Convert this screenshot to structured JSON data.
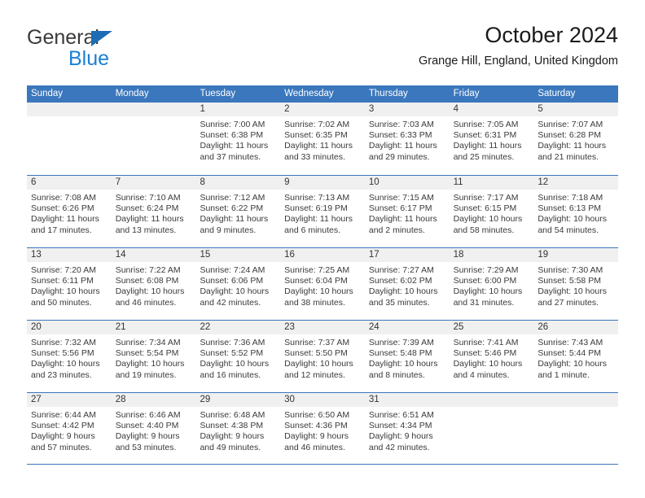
{
  "brand": {
    "name_top": "General",
    "name_bottom": "Blue",
    "triangle_color": "#1d6cb5",
    "blue_text_color": "#1b7fd4"
  },
  "header": {
    "title": "October 2024",
    "subtitle": "Grange Hill, England, United Kingdom"
  },
  "colors": {
    "header_blue": "#3b77bd",
    "day_band_gray": "#f0f0f0",
    "text": "#3a3a3a"
  },
  "weekdays": [
    "Sunday",
    "Monday",
    "Tuesday",
    "Wednesday",
    "Thursday",
    "Friday",
    "Saturday"
  ],
  "labels": {
    "sunrise": "Sunrise:",
    "sunset": "Sunset:",
    "daylight": "Daylight:"
  },
  "weeks": [
    [
      {
        "day": "",
        "sunrise": "",
        "sunset": "",
        "daylight_1": "",
        "daylight_2": ""
      },
      {
        "day": "",
        "sunrise": "",
        "sunset": "",
        "daylight_1": "",
        "daylight_2": ""
      },
      {
        "day": "1",
        "sunrise": "Sunrise: 7:00 AM",
        "sunset": "Sunset: 6:38 PM",
        "daylight_1": "Daylight: 11 hours",
        "daylight_2": "and 37 minutes."
      },
      {
        "day": "2",
        "sunrise": "Sunrise: 7:02 AM",
        "sunset": "Sunset: 6:35 PM",
        "daylight_1": "Daylight: 11 hours",
        "daylight_2": "and 33 minutes."
      },
      {
        "day": "3",
        "sunrise": "Sunrise: 7:03 AM",
        "sunset": "Sunset: 6:33 PM",
        "daylight_1": "Daylight: 11 hours",
        "daylight_2": "and 29 minutes."
      },
      {
        "day": "4",
        "sunrise": "Sunrise: 7:05 AM",
        "sunset": "Sunset: 6:31 PM",
        "daylight_1": "Daylight: 11 hours",
        "daylight_2": "and 25 minutes."
      },
      {
        "day": "5",
        "sunrise": "Sunrise: 7:07 AM",
        "sunset": "Sunset: 6:28 PM",
        "daylight_1": "Daylight: 11 hours",
        "daylight_2": "and 21 minutes."
      }
    ],
    [
      {
        "day": "6",
        "sunrise": "Sunrise: 7:08 AM",
        "sunset": "Sunset: 6:26 PM",
        "daylight_1": "Daylight: 11 hours",
        "daylight_2": "and 17 minutes."
      },
      {
        "day": "7",
        "sunrise": "Sunrise: 7:10 AM",
        "sunset": "Sunset: 6:24 PM",
        "daylight_1": "Daylight: 11 hours",
        "daylight_2": "and 13 minutes."
      },
      {
        "day": "8",
        "sunrise": "Sunrise: 7:12 AM",
        "sunset": "Sunset: 6:22 PM",
        "daylight_1": "Daylight: 11 hours",
        "daylight_2": "and 9 minutes."
      },
      {
        "day": "9",
        "sunrise": "Sunrise: 7:13 AM",
        "sunset": "Sunset: 6:19 PM",
        "daylight_1": "Daylight: 11 hours",
        "daylight_2": "and 6 minutes."
      },
      {
        "day": "10",
        "sunrise": "Sunrise: 7:15 AM",
        "sunset": "Sunset: 6:17 PM",
        "daylight_1": "Daylight: 11 hours",
        "daylight_2": "and 2 minutes."
      },
      {
        "day": "11",
        "sunrise": "Sunrise: 7:17 AM",
        "sunset": "Sunset: 6:15 PM",
        "daylight_1": "Daylight: 10 hours",
        "daylight_2": "and 58 minutes."
      },
      {
        "day": "12",
        "sunrise": "Sunrise: 7:18 AM",
        "sunset": "Sunset: 6:13 PM",
        "daylight_1": "Daylight: 10 hours",
        "daylight_2": "and 54 minutes."
      }
    ],
    [
      {
        "day": "13",
        "sunrise": "Sunrise: 7:20 AM",
        "sunset": "Sunset: 6:11 PM",
        "daylight_1": "Daylight: 10 hours",
        "daylight_2": "and 50 minutes."
      },
      {
        "day": "14",
        "sunrise": "Sunrise: 7:22 AM",
        "sunset": "Sunset: 6:08 PM",
        "daylight_1": "Daylight: 10 hours",
        "daylight_2": "and 46 minutes."
      },
      {
        "day": "15",
        "sunrise": "Sunrise: 7:24 AM",
        "sunset": "Sunset: 6:06 PM",
        "daylight_1": "Daylight: 10 hours",
        "daylight_2": "and 42 minutes."
      },
      {
        "day": "16",
        "sunrise": "Sunrise: 7:25 AM",
        "sunset": "Sunset: 6:04 PM",
        "daylight_1": "Daylight: 10 hours",
        "daylight_2": "and 38 minutes."
      },
      {
        "day": "17",
        "sunrise": "Sunrise: 7:27 AM",
        "sunset": "Sunset: 6:02 PM",
        "daylight_1": "Daylight: 10 hours",
        "daylight_2": "and 35 minutes."
      },
      {
        "day": "18",
        "sunrise": "Sunrise: 7:29 AM",
        "sunset": "Sunset: 6:00 PM",
        "daylight_1": "Daylight: 10 hours",
        "daylight_2": "and 31 minutes."
      },
      {
        "day": "19",
        "sunrise": "Sunrise: 7:30 AM",
        "sunset": "Sunset: 5:58 PM",
        "daylight_1": "Daylight: 10 hours",
        "daylight_2": "and 27 minutes."
      }
    ],
    [
      {
        "day": "20",
        "sunrise": "Sunrise: 7:32 AM",
        "sunset": "Sunset: 5:56 PM",
        "daylight_1": "Daylight: 10 hours",
        "daylight_2": "and 23 minutes."
      },
      {
        "day": "21",
        "sunrise": "Sunrise: 7:34 AM",
        "sunset": "Sunset: 5:54 PM",
        "daylight_1": "Daylight: 10 hours",
        "daylight_2": "and 19 minutes."
      },
      {
        "day": "22",
        "sunrise": "Sunrise: 7:36 AM",
        "sunset": "Sunset: 5:52 PM",
        "daylight_1": "Daylight: 10 hours",
        "daylight_2": "and 16 minutes."
      },
      {
        "day": "23",
        "sunrise": "Sunrise: 7:37 AM",
        "sunset": "Sunset: 5:50 PM",
        "daylight_1": "Daylight: 10 hours",
        "daylight_2": "and 12 minutes."
      },
      {
        "day": "24",
        "sunrise": "Sunrise: 7:39 AM",
        "sunset": "Sunset: 5:48 PM",
        "daylight_1": "Daylight: 10 hours",
        "daylight_2": "and 8 minutes."
      },
      {
        "day": "25",
        "sunrise": "Sunrise: 7:41 AM",
        "sunset": "Sunset: 5:46 PM",
        "daylight_1": "Daylight: 10 hours",
        "daylight_2": "and 4 minutes."
      },
      {
        "day": "26",
        "sunrise": "Sunrise: 7:43 AM",
        "sunset": "Sunset: 5:44 PM",
        "daylight_1": "Daylight: 10 hours",
        "daylight_2": "and 1 minute."
      }
    ],
    [
      {
        "day": "27",
        "sunrise": "Sunrise: 6:44 AM",
        "sunset": "Sunset: 4:42 PM",
        "daylight_1": "Daylight: 9 hours",
        "daylight_2": "and 57 minutes."
      },
      {
        "day": "28",
        "sunrise": "Sunrise: 6:46 AM",
        "sunset": "Sunset: 4:40 PM",
        "daylight_1": "Daylight: 9 hours",
        "daylight_2": "and 53 minutes."
      },
      {
        "day": "29",
        "sunrise": "Sunrise: 6:48 AM",
        "sunset": "Sunset: 4:38 PM",
        "daylight_1": "Daylight: 9 hours",
        "daylight_2": "and 49 minutes."
      },
      {
        "day": "30",
        "sunrise": "Sunrise: 6:50 AM",
        "sunset": "Sunset: 4:36 PM",
        "daylight_1": "Daylight: 9 hours",
        "daylight_2": "and 46 minutes."
      },
      {
        "day": "31",
        "sunrise": "Sunrise: 6:51 AM",
        "sunset": "Sunset: 4:34 PM",
        "daylight_1": "Daylight: 9 hours",
        "daylight_2": "and 42 minutes."
      },
      {
        "day": "",
        "sunrise": "",
        "sunset": "",
        "daylight_1": "",
        "daylight_2": ""
      },
      {
        "day": "",
        "sunrise": "",
        "sunset": "",
        "daylight_1": "",
        "daylight_2": ""
      }
    ]
  ]
}
